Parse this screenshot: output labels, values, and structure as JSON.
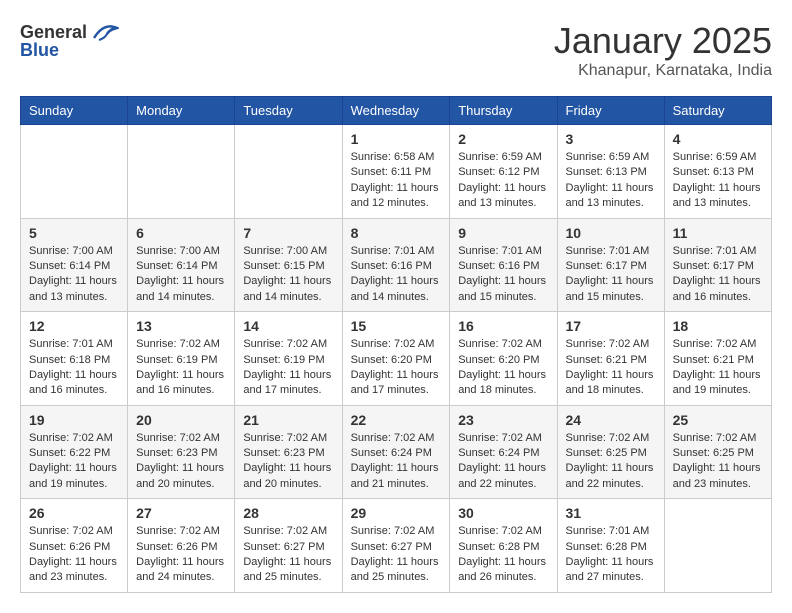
{
  "logo": {
    "text_general": "General",
    "text_blue": "Blue"
  },
  "header": {
    "month_year": "January 2025",
    "location": "Khanapur, Karnataka, India"
  },
  "weekdays": [
    "Sunday",
    "Monday",
    "Tuesday",
    "Wednesday",
    "Thursday",
    "Friday",
    "Saturday"
  ],
  "weeks": [
    [
      {
        "day": "",
        "info": ""
      },
      {
        "day": "",
        "info": ""
      },
      {
        "day": "",
        "info": ""
      },
      {
        "day": "1",
        "info": "Sunrise: 6:58 AM\nSunset: 6:11 PM\nDaylight: 11 hours\nand 12 minutes."
      },
      {
        "day": "2",
        "info": "Sunrise: 6:59 AM\nSunset: 6:12 PM\nDaylight: 11 hours\nand 13 minutes."
      },
      {
        "day": "3",
        "info": "Sunrise: 6:59 AM\nSunset: 6:13 PM\nDaylight: 11 hours\nand 13 minutes."
      },
      {
        "day": "4",
        "info": "Sunrise: 6:59 AM\nSunset: 6:13 PM\nDaylight: 11 hours\nand 13 minutes."
      }
    ],
    [
      {
        "day": "5",
        "info": "Sunrise: 7:00 AM\nSunset: 6:14 PM\nDaylight: 11 hours\nand 13 minutes."
      },
      {
        "day": "6",
        "info": "Sunrise: 7:00 AM\nSunset: 6:14 PM\nDaylight: 11 hours\nand 14 minutes."
      },
      {
        "day": "7",
        "info": "Sunrise: 7:00 AM\nSunset: 6:15 PM\nDaylight: 11 hours\nand 14 minutes."
      },
      {
        "day": "8",
        "info": "Sunrise: 7:01 AM\nSunset: 6:16 PM\nDaylight: 11 hours\nand 14 minutes."
      },
      {
        "day": "9",
        "info": "Sunrise: 7:01 AM\nSunset: 6:16 PM\nDaylight: 11 hours\nand 15 minutes."
      },
      {
        "day": "10",
        "info": "Sunrise: 7:01 AM\nSunset: 6:17 PM\nDaylight: 11 hours\nand 15 minutes."
      },
      {
        "day": "11",
        "info": "Sunrise: 7:01 AM\nSunset: 6:17 PM\nDaylight: 11 hours\nand 16 minutes."
      }
    ],
    [
      {
        "day": "12",
        "info": "Sunrise: 7:01 AM\nSunset: 6:18 PM\nDaylight: 11 hours\nand 16 minutes."
      },
      {
        "day": "13",
        "info": "Sunrise: 7:02 AM\nSunset: 6:19 PM\nDaylight: 11 hours\nand 16 minutes."
      },
      {
        "day": "14",
        "info": "Sunrise: 7:02 AM\nSunset: 6:19 PM\nDaylight: 11 hours\nand 17 minutes."
      },
      {
        "day": "15",
        "info": "Sunrise: 7:02 AM\nSunset: 6:20 PM\nDaylight: 11 hours\nand 17 minutes."
      },
      {
        "day": "16",
        "info": "Sunrise: 7:02 AM\nSunset: 6:20 PM\nDaylight: 11 hours\nand 18 minutes."
      },
      {
        "day": "17",
        "info": "Sunrise: 7:02 AM\nSunset: 6:21 PM\nDaylight: 11 hours\nand 18 minutes."
      },
      {
        "day": "18",
        "info": "Sunrise: 7:02 AM\nSunset: 6:21 PM\nDaylight: 11 hours\nand 19 minutes."
      }
    ],
    [
      {
        "day": "19",
        "info": "Sunrise: 7:02 AM\nSunset: 6:22 PM\nDaylight: 11 hours\nand 19 minutes."
      },
      {
        "day": "20",
        "info": "Sunrise: 7:02 AM\nSunset: 6:23 PM\nDaylight: 11 hours\nand 20 minutes."
      },
      {
        "day": "21",
        "info": "Sunrise: 7:02 AM\nSunset: 6:23 PM\nDaylight: 11 hours\nand 20 minutes."
      },
      {
        "day": "22",
        "info": "Sunrise: 7:02 AM\nSunset: 6:24 PM\nDaylight: 11 hours\nand 21 minutes."
      },
      {
        "day": "23",
        "info": "Sunrise: 7:02 AM\nSunset: 6:24 PM\nDaylight: 11 hours\nand 22 minutes."
      },
      {
        "day": "24",
        "info": "Sunrise: 7:02 AM\nSunset: 6:25 PM\nDaylight: 11 hours\nand 22 minutes."
      },
      {
        "day": "25",
        "info": "Sunrise: 7:02 AM\nSunset: 6:25 PM\nDaylight: 11 hours\nand 23 minutes."
      }
    ],
    [
      {
        "day": "26",
        "info": "Sunrise: 7:02 AM\nSunset: 6:26 PM\nDaylight: 11 hours\nand 23 minutes."
      },
      {
        "day": "27",
        "info": "Sunrise: 7:02 AM\nSunset: 6:26 PM\nDaylight: 11 hours\nand 24 minutes."
      },
      {
        "day": "28",
        "info": "Sunrise: 7:02 AM\nSunset: 6:27 PM\nDaylight: 11 hours\nand 25 minutes."
      },
      {
        "day": "29",
        "info": "Sunrise: 7:02 AM\nSunset: 6:27 PM\nDaylight: 11 hours\nand 25 minutes."
      },
      {
        "day": "30",
        "info": "Sunrise: 7:02 AM\nSunset: 6:28 PM\nDaylight: 11 hours\nand 26 minutes."
      },
      {
        "day": "31",
        "info": "Sunrise: 7:01 AM\nSunset: 6:28 PM\nDaylight: 11 hours\nand 27 minutes."
      },
      {
        "day": "",
        "info": ""
      }
    ]
  ]
}
